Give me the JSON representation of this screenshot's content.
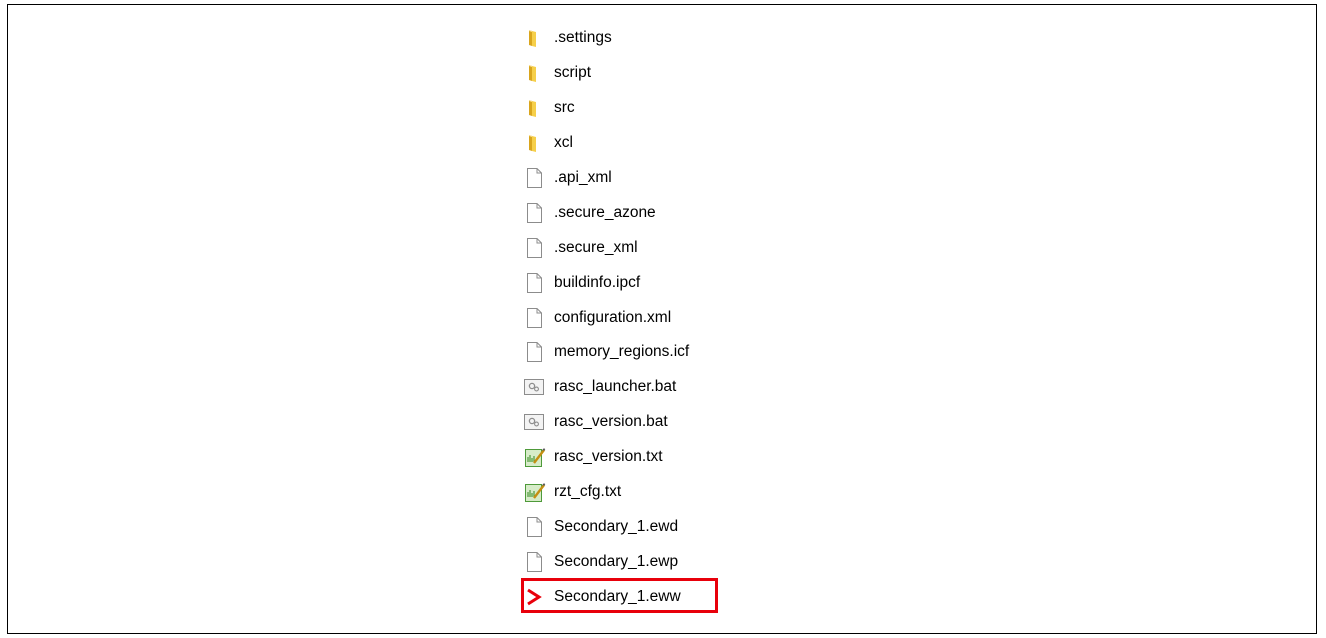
{
  "explorer": {
    "items": [
      {
        "name": ".settings",
        "type": "folder",
        "icon": "folder-icon"
      },
      {
        "name": "script",
        "type": "folder",
        "icon": "folder-icon"
      },
      {
        "name": "src",
        "type": "folder",
        "icon": "folder-icon"
      },
      {
        "name": "xcl",
        "type": "folder",
        "icon": "folder-icon"
      },
      {
        "name": ".api_xml",
        "type": "file",
        "icon": "blank-file-icon"
      },
      {
        "name": ".secure_azone",
        "type": "file",
        "icon": "blank-file-icon"
      },
      {
        "name": ".secure_xml",
        "type": "file",
        "icon": "blank-file-icon"
      },
      {
        "name": "buildinfo.ipcf",
        "type": "file",
        "icon": "blank-file-icon"
      },
      {
        "name": "configuration.xml",
        "type": "file",
        "icon": "blank-file-icon"
      },
      {
        "name": "memory_regions.icf",
        "type": "file",
        "icon": "blank-file-icon"
      },
      {
        "name": "rasc_launcher.bat",
        "type": "batch",
        "icon": "batch-file-icon"
      },
      {
        "name": "rasc_version.bat",
        "type": "batch",
        "icon": "batch-file-icon"
      },
      {
        "name": "rasc_version.txt",
        "type": "text",
        "icon": "text-file-icon"
      },
      {
        "name": "rzt_cfg.txt",
        "type": "text",
        "icon": "text-file-icon"
      },
      {
        "name": "Secondary_1.ewd",
        "type": "file",
        "icon": "blank-file-icon"
      },
      {
        "name": "Secondary_1.ewp",
        "type": "file",
        "icon": "blank-file-icon"
      },
      {
        "name": "Secondary_1.eww",
        "type": "workspace",
        "icon": "iar-workspace-icon"
      }
    ],
    "highlighted_item": "Secondary_1.eww",
    "highlight_color": "#e8000b"
  }
}
